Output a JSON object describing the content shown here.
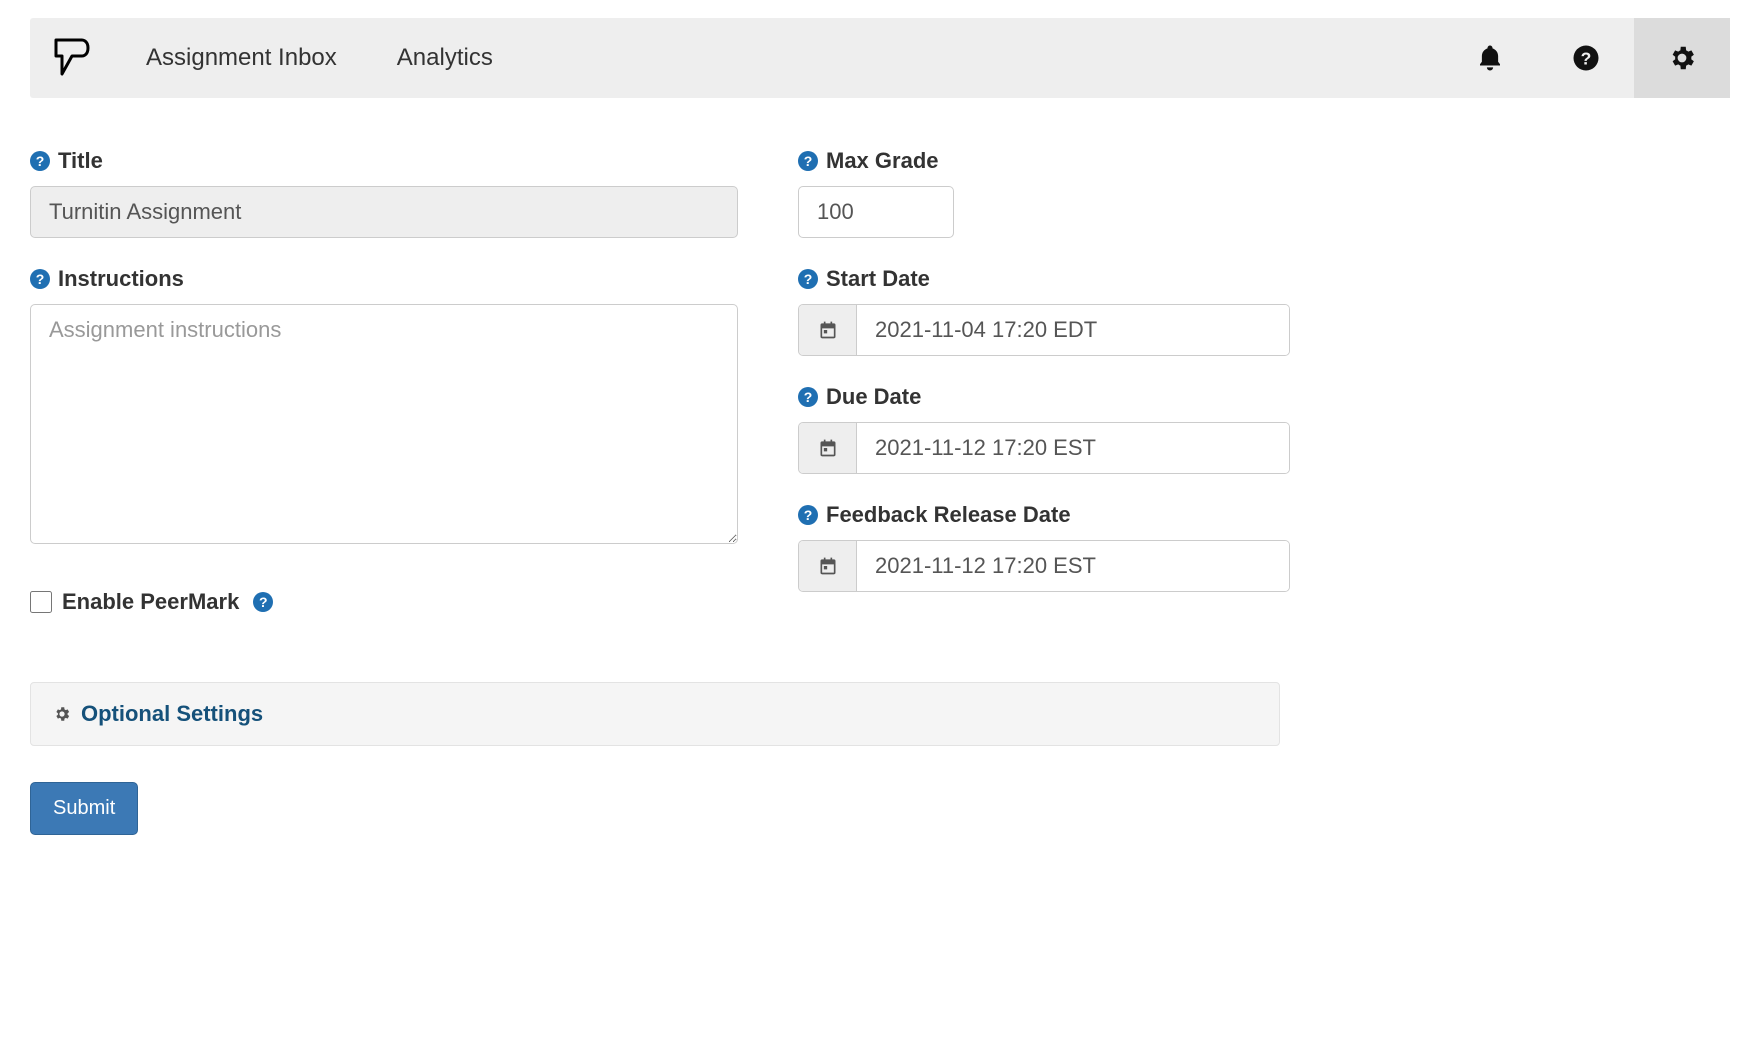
{
  "nav": {
    "items": [
      "Assignment Inbox",
      "Analytics"
    ]
  },
  "form": {
    "title": {
      "label": "Title",
      "value": "Turnitin Assignment"
    },
    "instructions": {
      "label": "Instructions",
      "placeholder": "Assignment instructions",
      "value": ""
    },
    "peermark": {
      "label": "Enable PeerMark",
      "checked": false
    },
    "max_grade": {
      "label": "Max Grade",
      "value": "100"
    },
    "start_date": {
      "label": "Start Date",
      "value": "2021-11-04 17:20 EDT"
    },
    "due_date": {
      "label": "Due Date",
      "value": "2021-11-12 17:20 EST"
    },
    "feedback_date": {
      "label": "Feedback Release Date",
      "value": "2021-11-12 17:20 EST"
    },
    "optional_settings_label": "Optional Settings",
    "submit_label": "Submit"
  }
}
